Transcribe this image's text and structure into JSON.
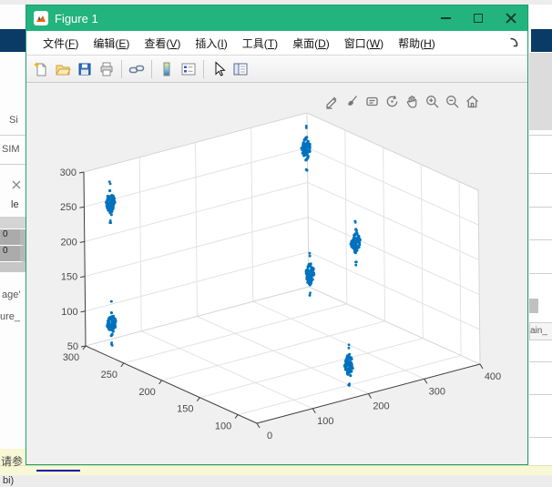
{
  "window": {
    "title": "Figure 1",
    "controls": [
      "minimize",
      "maximize",
      "close"
    ]
  },
  "menu": {
    "items": [
      {
        "key": "file",
        "label": "文件(F)"
      },
      {
        "key": "edit",
        "label": "编辑(E)"
      },
      {
        "key": "view",
        "label": "查看(V)"
      },
      {
        "key": "insert",
        "label": "插入(I)"
      },
      {
        "key": "tools",
        "label": "工具(T)"
      },
      {
        "key": "desktop",
        "label": "桌面(D)"
      },
      {
        "key": "window",
        "label": "窗口(W)"
      },
      {
        "key": "help",
        "label": "帮助(H)"
      }
    ],
    "dock_arrow": "dock-arrow-icon"
  },
  "toolbar": {
    "icons": [
      "new-figure",
      "open-file",
      "save-figure",
      "print-figure",
      "link-plot",
      "insert-colorbar",
      "insert-legend",
      "edit-plot",
      "property-inspector"
    ]
  },
  "axes_toolbar": {
    "icons": [
      "export",
      "brush",
      "datatips",
      "rotate-3d",
      "pan",
      "zoom-in",
      "zoom-out",
      "restore-view"
    ]
  },
  "chart_data": {
    "type": "scatter",
    "projection": "3d",
    "title": "",
    "xlabel": "",
    "ylabel": "",
    "zlabel": "",
    "xlim": [
      0,
      400
    ],
    "ylim": [
      75,
      300
    ],
    "zlim": [
      50,
      300
    ],
    "x_ticks": [
      0,
      100,
      200,
      300,
      400
    ],
    "y_ticks": [
      100,
      150,
      200,
      250,
      300
    ],
    "z_ticks": [
      50,
      100,
      150,
      200,
      250,
      300
    ],
    "grid": true,
    "legend": null,
    "marker_color": "#0072BD",
    "clusters": [
      {
        "x": 40,
        "y": 295,
        "z": 250,
        "z_spread": 22,
        "x_spread": 9,
        "n": 70
      },
      {
        "x": 40,
        "y": 295,
        "z": 75,
        "z_spread": 22,
        "x_spread": 9,
        "n": 70
      },
      {
        "x": 398,
        "y": 300,
        "z": 250,
        "z_spread": 22,
        "x_spread": 9,
        "n": 70
      },
      {
        "x": 390,
        "y": 230,
        "z": 150,
        "z_spread": 22,
        "x_spread": 9,
        "n": 70
      },
      {
        "x": 260,
        "y": 195,
        "z": 150,
        "z_spread": 22,
        "x_spread": 9,
        "n": 70
      },
      {
        "x": 240,
        "y": 130,
        "z": 55,
        "z_spread": 22,
        "x_spread": 9,
        "n": 70
      }
    ]
  },
  "background": {
    "left": {
      "si": "Si",
      "sim": "SIM",
      "le": "le",
      "cells": [
        "0",
        "0"
      ],
      "age": "age'",
      "ure": "ure_"
    },
    "right": {
      "tab_text": "ain_"
    },
    "bottom": {
      "ref_text": "请参",
      "code_text": "bi)"
    }
  }
}
